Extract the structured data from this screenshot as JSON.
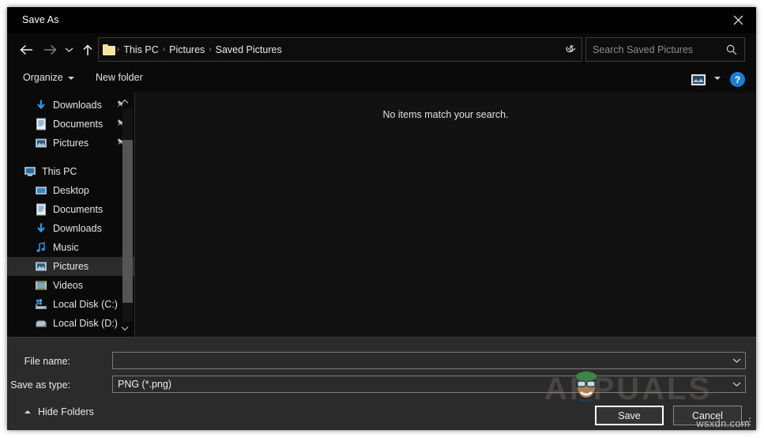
{
  "window": {
    "title": "Save As",
    "close_label": "✕",
    "close_icon": "close-icon"
  },
  "navigation": {
    "back": "back-arrow-icon",
    "forward": "forward-arrow-icon",
    "recent": "recent-locations-chevron-icon",
    "up": "up-arrow-icon"
  },
  "address": {
    "folder_icon": "folder-icon",
    "separator": "›",
    "crumbs": [
      "This PC",
      "Pictures",
      "Saved Pictures"
    ],
    "dropdown_icon": "chevron-down-icon",
    "refresh_icon": "↺"
  },
  "search": {
    "placeholder": "Search Saved Pictures",
    "icon": "search-icon"
  },
  "commandbar": {
    "organize": "Organize",
    "new_folder": "New folder",
    "view_icon": "view-layout-icon",
    "view_caret": "chevron-down-icon",
    "help": "?"
  },
  "sidebar": {
    "items": [
      {
        "label": "Downloads",
        "icon": "download-arrow-icon",
        "pinned": true,
        "indent": 1,
        "selected": false
      },
      {
        "label": "Documents",
        "icon": "document-icon",
        "pinned": true,
        "indent": 1,
        "selected": false
      },
      {
        "label": "Pictures",
        "icon": "picture-icon",
        "pinned": true,
        "indent": 1,
        "selected": false
      },
      {
        "label": "This PC",
        "icon": "this-pc-icon",
        "pinned": false,
        "indent": 0,
        "selected": false
      },
      {
        "label": "Desktop",
        "icon": "desktop-icon",
        "pinned": false,
        "indent": 1,
        "selected": false
      },
      {
        "label": "Documents",
        "icon": "document-icon",
        "pinned": false,
        "indent": 1,
        "selected": false
      },
      {
        "label": "Downloads",
        "icon": "download-arrow-icon",
        "pinned": false,
        "indent": 1,
        "selected": false
      },
      {
        "label": "Music",
        "icon": "music-note-icon",
        "pinned": false,
        "indent": 1,
        "selected": false
      },
      {
        "label": "Pictures",
        "icon": "picture-icon",
        "pinned": false,
        "indent": 1,
        "selected": true
      },
      {
        "label": "Videos",
        "icon": "video-icon",
        "pinned": false,
        "indent": 1,
        "selected": false
      },
      {
        "label": "Local Disk (C:)",
        "icon": "system-drive-icon",
        "pinned": false,
        "indent": 1,
        "selected": false
      },
      {
        "label": "Local Disk (D:)",
        "icon": "drive-icon",
        "pinned": false,
        "indent": 1,
        "selected": false
      }
    ],
    "scroll_up_icon": "chevron-up-icon",
    "scroll_down_icon": "chevron-down-icon"
  },
  "filelist": {
    "empty_message": "No items match your search."
  },
  "form": {
    "filename_label": "File name:",
    "filename_value": "",
    "filename_dropdown_icon": "chevron-down-icon",
    "savetype_label": "Save as type:",
    "savetype_value": "PNG (*.png)",
    "savetype_dropdown_icon": "chevron-down-icon"
  },
  "footer": {
    "hide_folders": "Hide Folders",
    "hide_folders_icon": "chevron-up-icon",
    "save": "Save",
    "cancel": "Cancel",
    "resize_grip": "resize-grip-icon"
  },
  "watermarks": {
    "brand": "APPUALS",
    "site": "wsxdn.com"
  },
  "colors": {
    "window_bg": "#000000",
    "panel_bg": "#121212",
    "form_bg": "#2b2b2b",
    "accent_blue": "#1a7fd4",
    "folder_yellow": "#f5e3a0",
    "selection": "#2b2b2b",
    "text": "#e8e8e8",
    "muted_text": "#8d8d8d"
  }
}
